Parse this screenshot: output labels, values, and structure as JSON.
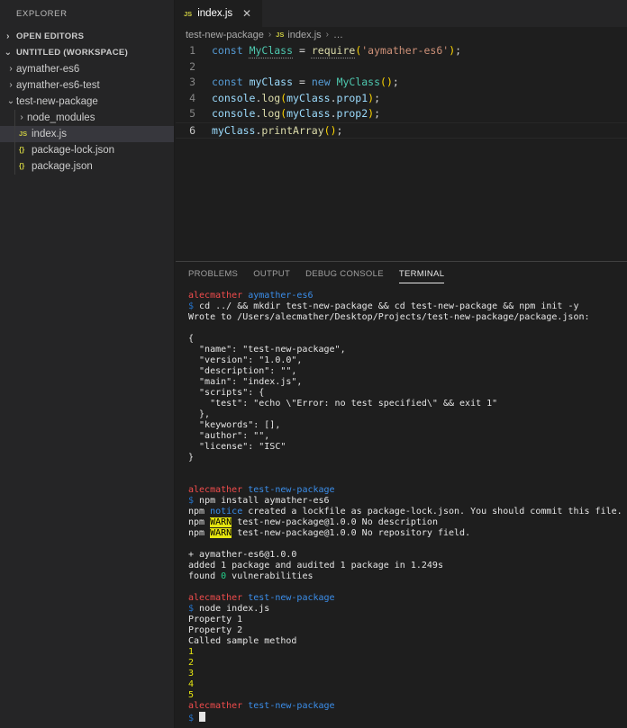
{
  "sidebar": {
    "title": "EXPLORER",
    "open_editors": "OPEN EDITORS",
    "workspace": "UNTITLED (WORKSPACE)",
    "folders": [
      "aymather-es6",
      "aymather-es6-test",
      "test-new-package"
    ],
    "children": [
      "node_modules",
      "index.js",
      "package-lock.json",
      "package.json"
    ],
    "js_badge": "JS",
    "json_badge": "{}"
  },
  "editor": {
    "tab_label": "index.js",
    "tab_badge": "JS",
    "close_glyph": "✕",
    "breadcrumb": {
      "folder": "test-new-package",
      "file": "index.js",
      "more": "…"
    },
    "line_numbers": [
      "1",
      "2",
      "3",
      "4",
      "5",
      "6"
    ],
    "code": {
      "l1": [
        "const",
        "MyClass",
        "=",
        "require",
        "(",
        "'aymather-es6'",
        ")",
        ";"
      ],
      "l3": [
        "const",
        "myClass",
        "=",
        "new",
        "MyClass",
        "(",
        ")",
        ";"
      ],
      "l4": [
        "console",
        ".",
        "log",
        "(",
        "myClass",
        ".",
        "prop1",
        ")",
        ";"
      ],
      "l5": [
        "console",
        ".",
        "log",
        "(",
        "myClass",
        ".",
        "prop2",
        ")",
        ";"
      ],
      "l6": [
        "myClass",
        ".",
        "printArray",
        "(",
        ")",
        ";"
      ]
    }
  },
  "panel": {
    "tabs": [
      "PROBLEMS",
      "OUTPUT",
      "DEBUG CONSOLE",
      "TERMINAL"
    ],
    "active_tab": "TERMINAL"
  },
  "terminal": {
    "user": "alecmather",
    "dir1": "aymather-es6",
    "dir2": "test-new-package",
    "prompt": "$",
    "cmd1": " cd ../ && mkdir test-new-package && cd test-new-package && npm init -y",
    "wrote": "Wrote to /Users/alecmather/Desktop/Projects/test-new-package/package.json:",
    "json_lines": [
      "{",
      "  \"name\": \"test-new-package\",",
      "  \"version\": \"1.0.0\",",
      "  \"description\": \"\",",
      "  \"main\": \"index.js\",",
      "  \"scripts\": {",
      "    \"test\": \"echo \\\"Error: no test specified\\\" && exit 1\"",
      "  },",
      "  \"keywords\": [],",
      "  \"author\": \"\",",
      "  \"license\": \"ISC\"",
      "}"
    ],
    "cmd2": " npm install aymather-es6",
    "npm": "npm",
    "notice": "notice",
    "notice_msg": " created a lockfile as package-lock.json. You should commit this file.",
    "warn": "WARN",
    "warn_msg1": " test-new-package@1.0.0 No description",
    "warn_msg2": " test-new-package@1.0.0 No repository field.",
    "added_pkg": "+ aymather-es6@1.0.0",
    "added": "added 1 package and audited 1 package in 1.249s",
    "found_pre": "found ",
    "found_num": "0",
    "found_post": " vulnerabilities",
    "cmd3": " node index.js",
    "output": [
      "Property 1",
      "Property 2",
      "Called sample method"
    ],
    "numbers": [
      "1",
      "2",
      "3",
      "4",
      "5"
    ]
  }
}
